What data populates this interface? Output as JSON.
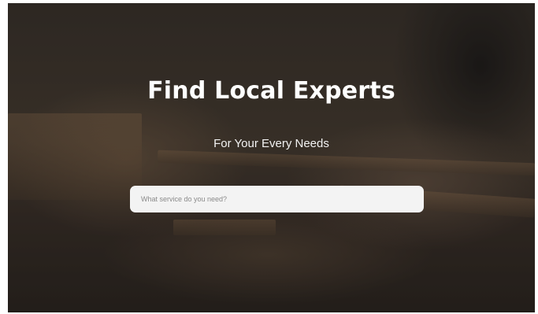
{
  "hero": {
    "title": "Find Local Experts",
    "subtitle": "For Your Every Needs"
  },
  "search": {
    "value": "",
    "placeholder": "What service do you need?"
  },
  "colors": {
    "title_text": "#ffffff",
    "search_bg": "#f3f3f3",
    "placeholder_text": "#8a8a8a"
  }
}
